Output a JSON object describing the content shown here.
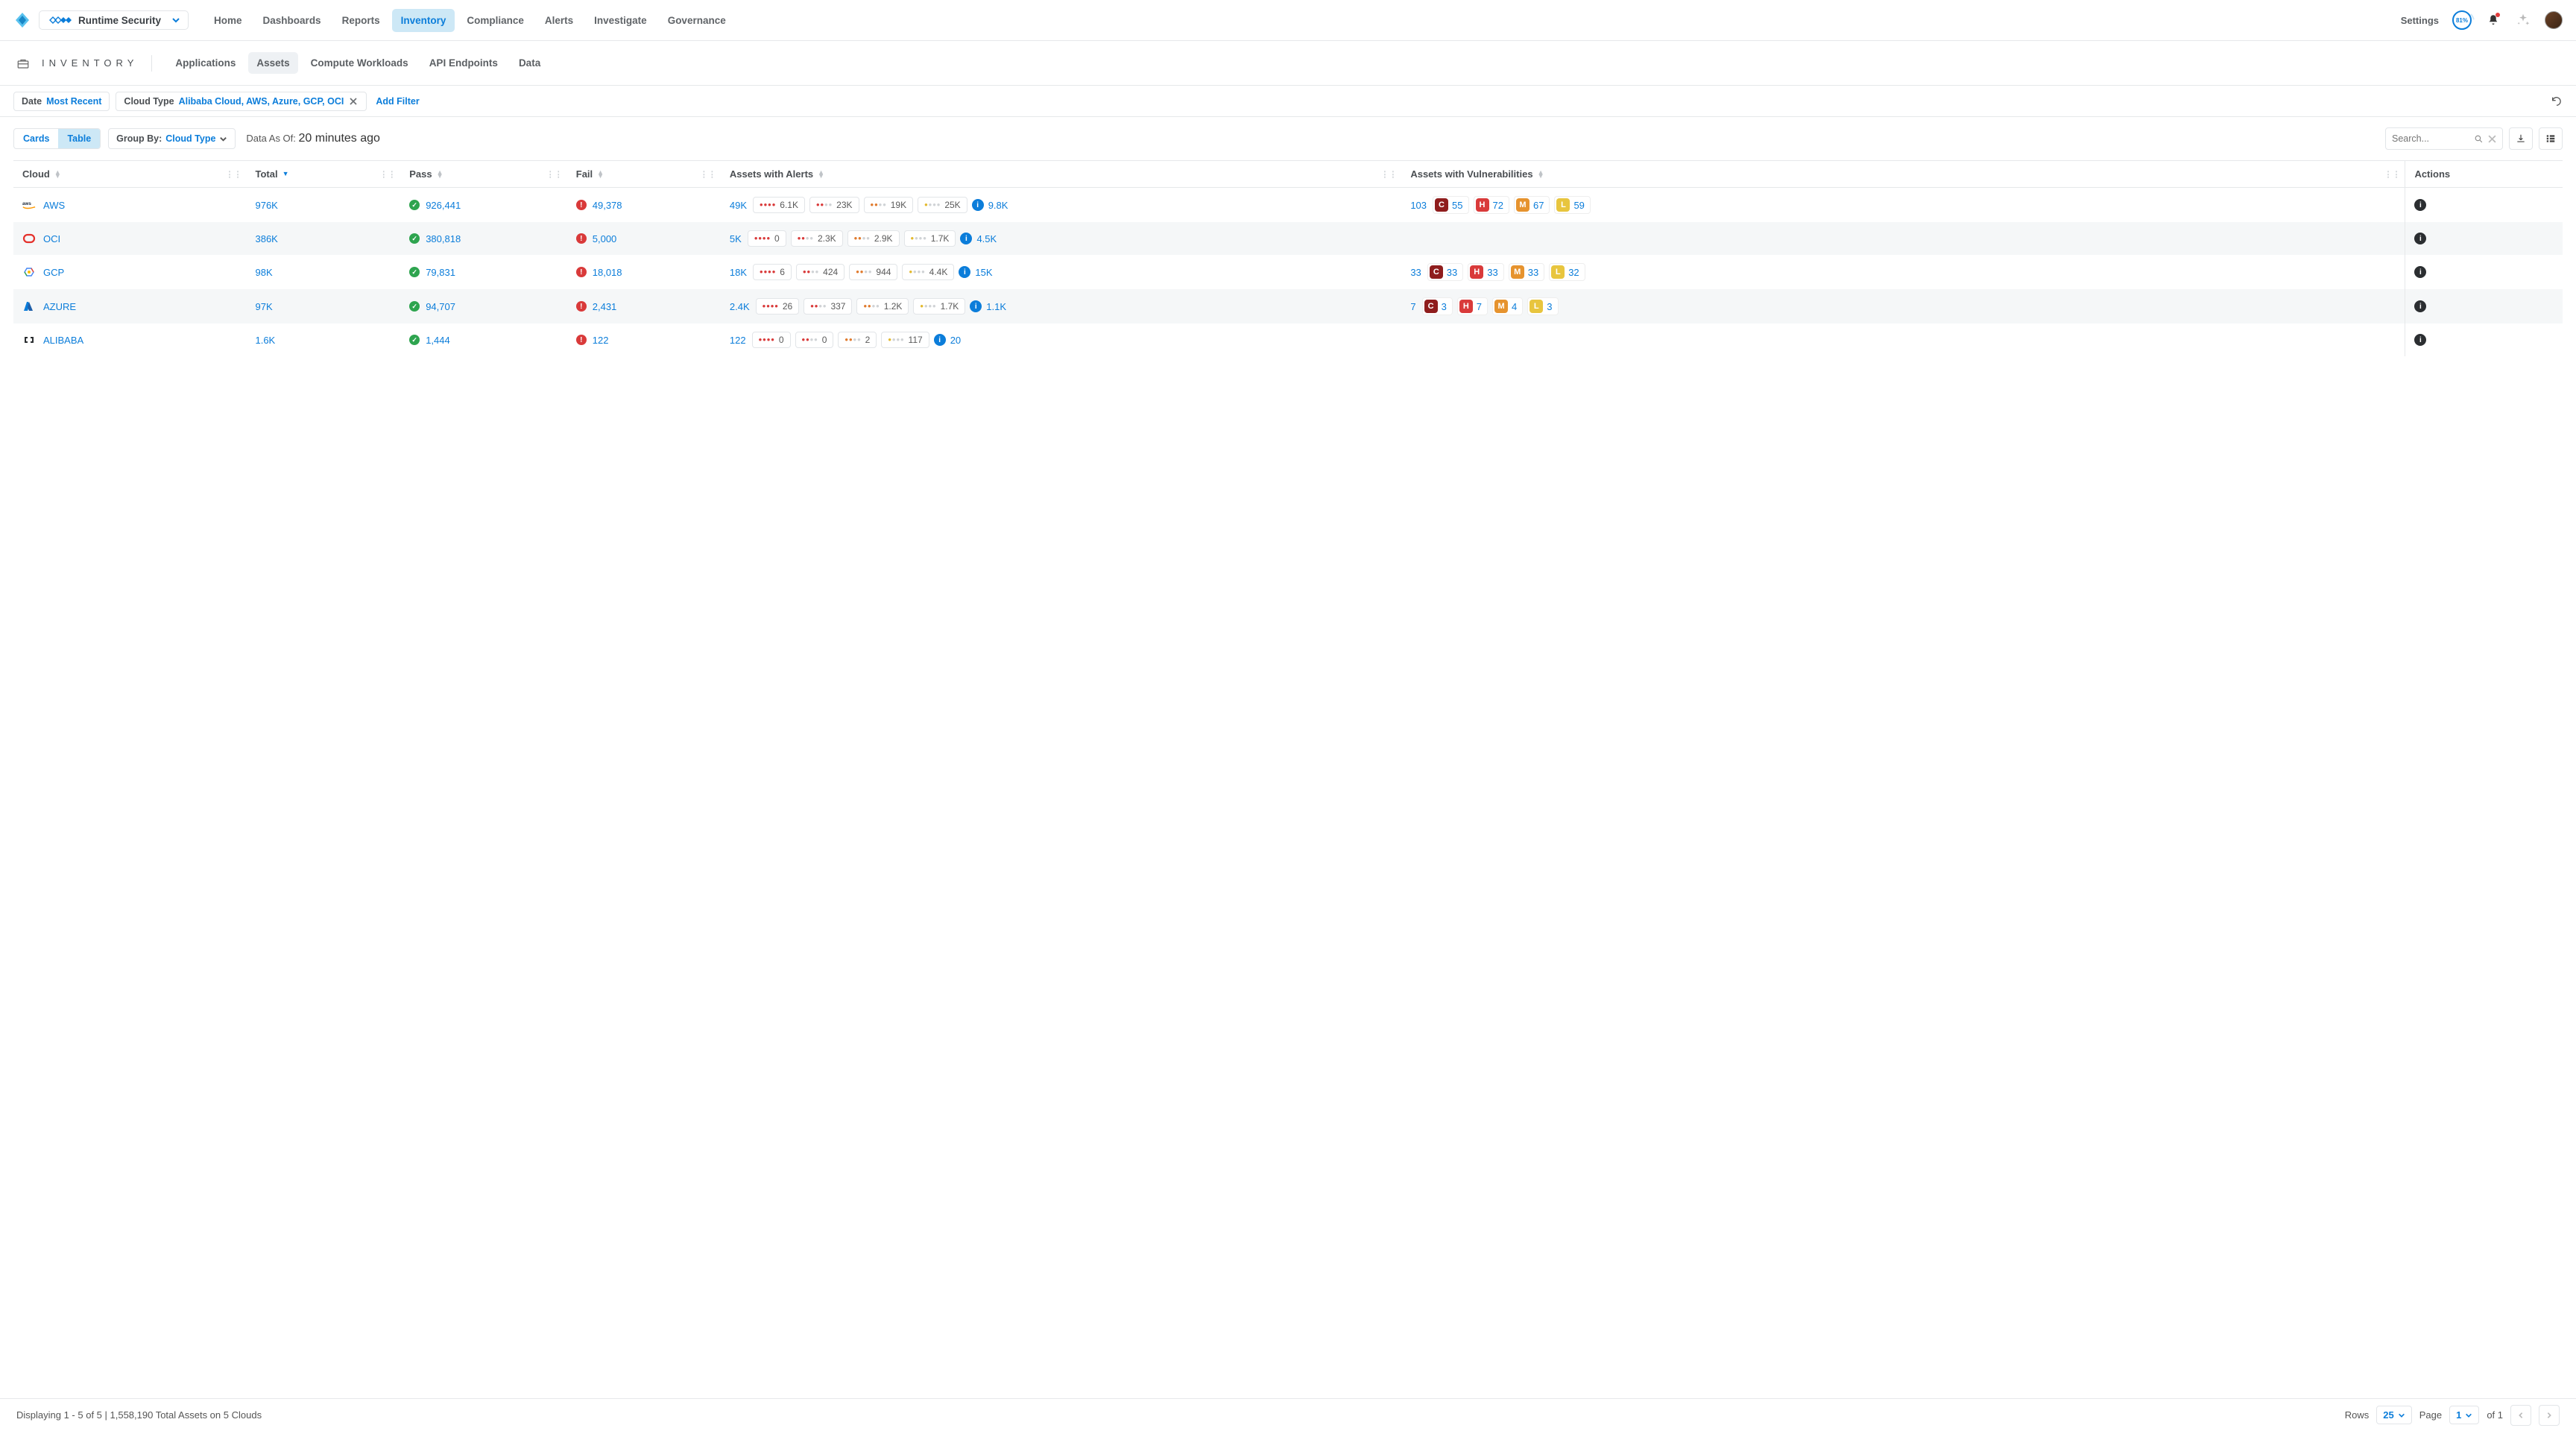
{
  "module": {
    "name": "Runtime Security"
  },
  "mainnav": [
    "Home",
    "Dashboards",
    "Reports",
    "Inventory",
    "Compliance",
    "Alerts",
    "Investigate",
    "Governance"
  ],
  "mainnav_active": 3,
  "topbar": {
    "settings": "Settings",
    "pct": "81%"
  },
  "page": {
    "title": "INVENTORY"
  },
  "subnav": [
    "Applications",
    "Assets",
    "Compute Workloads",
    "API Endpoints",
    "Data"
  ],
  "subnav_active": 1,
  "filters": {
    "date_label": "Date",
    "date_value": "Most Recent",
    "cloud_label": "Cloud Type",
    "cloud_value": "Alibaba Cloud, AWS, Azure, GCP, OCI",
    "add": "Add Filter"
  },
  "view": {
    "cards": "Cards",
    "table": "Table",
    "groupby_label": "Group By:",
    "groupby_value": "Cloud Type",
    "asof_label": "Data As Of:",
    "asof_value": "20 minutes ago",
    "search_placeholder": "Search..."
  },
  "columns": {
    "cloud": "Cloud",
    "total": "Total",
    "pass": "Pass",
    "fail": "Fail",
    "alerts": "Assets with Alerts",
    "vulns": "Assets with Vulnerabilities",
    "actions": "Actions"
  },
  "rows": [
    {
      "cloud": "AWS",
      "icon": "aws",
      "total": "976K",
      "pass": "926,441",
      "fail": "49,378",
      "alerts": {
        "lead": "49K",
        "r": "6.1K",
        "o": "23K",
        "y": "19K",
        "y2": "25K",
        "info": "9.8K"
      },
      "vulns": {
        "lead": "103",
        "C": "55",
        "H": "72",
        "M": "67",
        "L": "59"
      }
    },
    {
      "cloud": "OCI",
      "icon": "oci",
      "total": "386K",
      "pass": "380,818",
      "fail": "5,000",
      "alerts": {
        "lead": "5K",
        "r": "0",
        "o": "2.3K",
        "y": "2.9K",
        "y2": "1.7K",
        "info": "4.5K"
      },
      "vulns": null
    },
    {
      "cloud": "GCP",
      "icon": "gcp",
      "total": "98K",
      "pass": "79,831",
      "fail": "18,018",
      "alerts": {
        "lead": "18K",
        "r": "6",
        "o": "424",
        "y": "944",
        "y2": "4.4K",
        "info": "15K"
      },
      "vulns": {
        "lead": "33",
        "C": "33",
        "H": "33",
        "M": "33",
        "L": "32"
      }
    },
    {
      "cloud": "AZURE",
      "icon": "azure",
      "total": "97K",
      "pass": "94,707",
      "fail": "2,431",
      "alerts": {
        "lead": "2.4K",
        "r": "26",
        "o": "337",
        "y": "1.2K",
        "y2": "1.7K",
        "info": "1.1K"
      },
      "vulns": {
        "lead": "7",
        "C": "3",
        "H": "7",
        "M": "4",
        "L": "3"
      }
    },
    {
      "cloud": "ALIBABA",
      "icon": "alibaba",
      "total": "1.6K",
      "pass": "1,444",
      "fail": "122",
      "alerts": {
        "lead": "122",
        "r": "0",
        "o": "0",
        "y": "2",
        "y2": "117",
        "info": "20"
      },
      "vulns": null
    }
  ],
  "footer": {
    "left": "Displaying 1 - 5 of 5  |  1,558,190 Total Assets on 5 Clouds",
    "rows_label": "Rows",
    "rows_value": "25",
    "page_label": "Page",
    "page_value": "1",
    "page_of": "of 1"
  }
}
